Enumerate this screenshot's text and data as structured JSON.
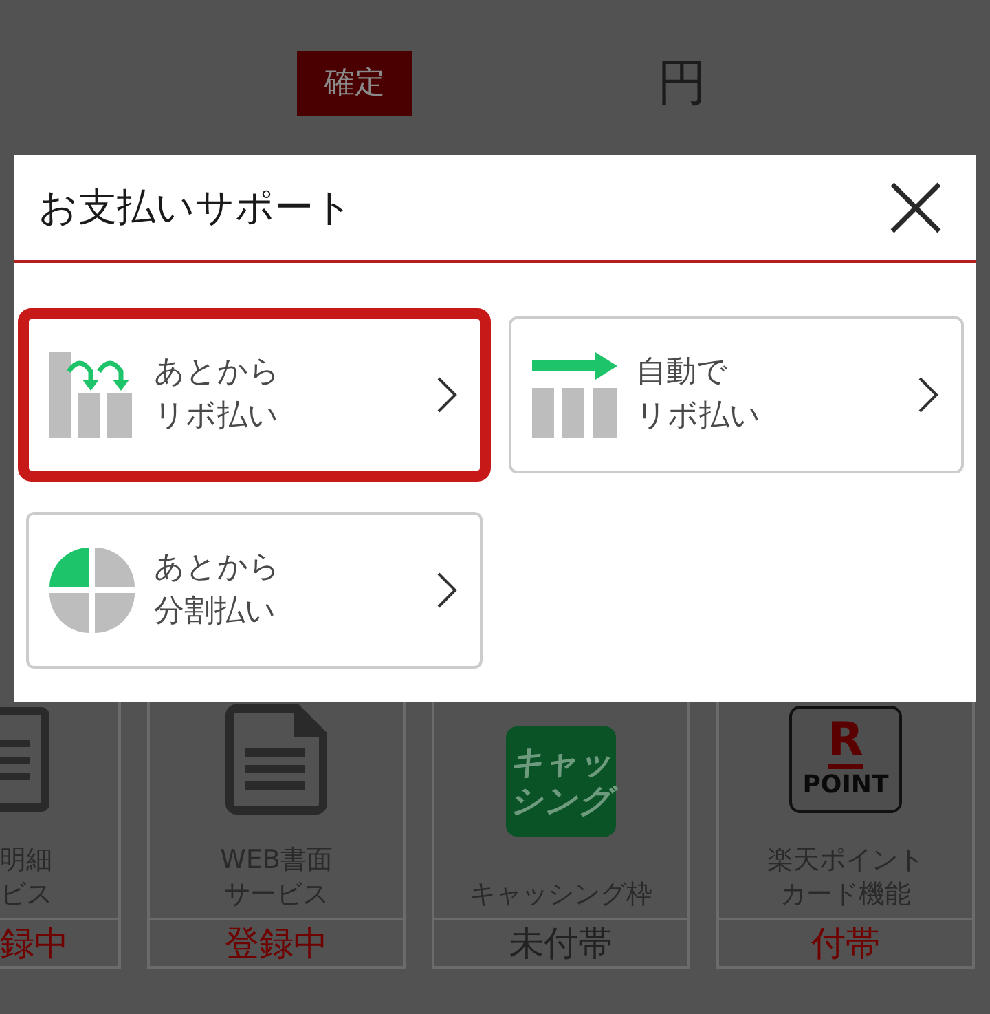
{
  "header": {
    "confirm_badge": "確定",
    "currency": "円"
  },
  "modal": {
    "title": "お支払いサポート",
    "options": [
      {
        "kind": "revo-later",
        "lines": [
          "あとから",
          "リボ払い"
        ],
        "selected": true
      },
      {
        "kind": "auto-revo",
        "lines": [
          "自動で",
          "リボ払い"
        ],
        "selected": false
      },
      {
        "kind": "installment-later",
        "lines": [
          "あとから",
          "分割払い"
        ],
        "selected": false
      }
    ]
  },
  "services": [
    {
      "kind": "statement",
      "label_lines": [
        "明細",
        "ビス"
      ],
      "status": "録中",
      "registered": true
    },
    {
      "kind": "document",
      "label_lines": [
        "WEB書面",
        "サービス"
      ],
      "status": "登録中",
      "registered": true
    },
    {
      "kind": "cashing",
      "icon_lines": [
        "キャッ",
        "シング"
      ],
      "label_lines": [
        "キャッシング枠"
      ],
      "status": "未付帯",
      "registered": false
    },
    {
      "kind": "point",
      "icon_lines": [
        "R",
        "POINT"
      ],
      "label_lines": [
        "楽天ポイント",
        "カード機能"
      ],
      "status": "付帯",
      "registered": true
    }
  ]
}
